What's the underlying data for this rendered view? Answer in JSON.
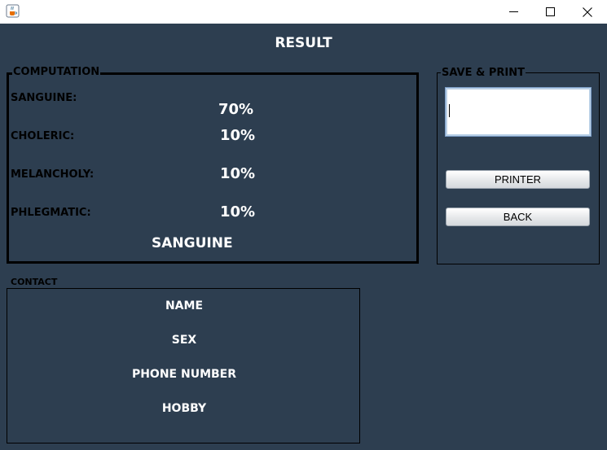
{
  "window": {
    "icon": "java-cup-icon",
    "controls": [
      "minimize-icon",
      "maximize-icon",
      "close-icon"
    ]
  },
  "header": {
    "title": "RESULT"
  },
  "computation": {
    "legend": "COMPUTATION",
    "rows": [
      {
        "label": "SANGUINE:",
        "value": "70%"
      },
      {
        "label": "CHOLERIC:",
        "value": "10%"
      },
      {
        "label": "MELANCHOLY:",
        "value": "10%"
      },
      {
        "label": "PHLEGMATIC:",
        "value": "10%"
      }
    ],
    "result": "SANGUINE"
  },
  "save_print": {
    "legend": "SAVE & PRINT",
    "input_value": "",
    "printer_label": "PRINTER",
    "back_label": "BACK"
  },
  "contact": {
    "legend": "CONTACT",
    "fields": [
      "NAME",
      "SEX",
      "PHONE NUMBER",
      "HOBBY"
    ]
  }
}
